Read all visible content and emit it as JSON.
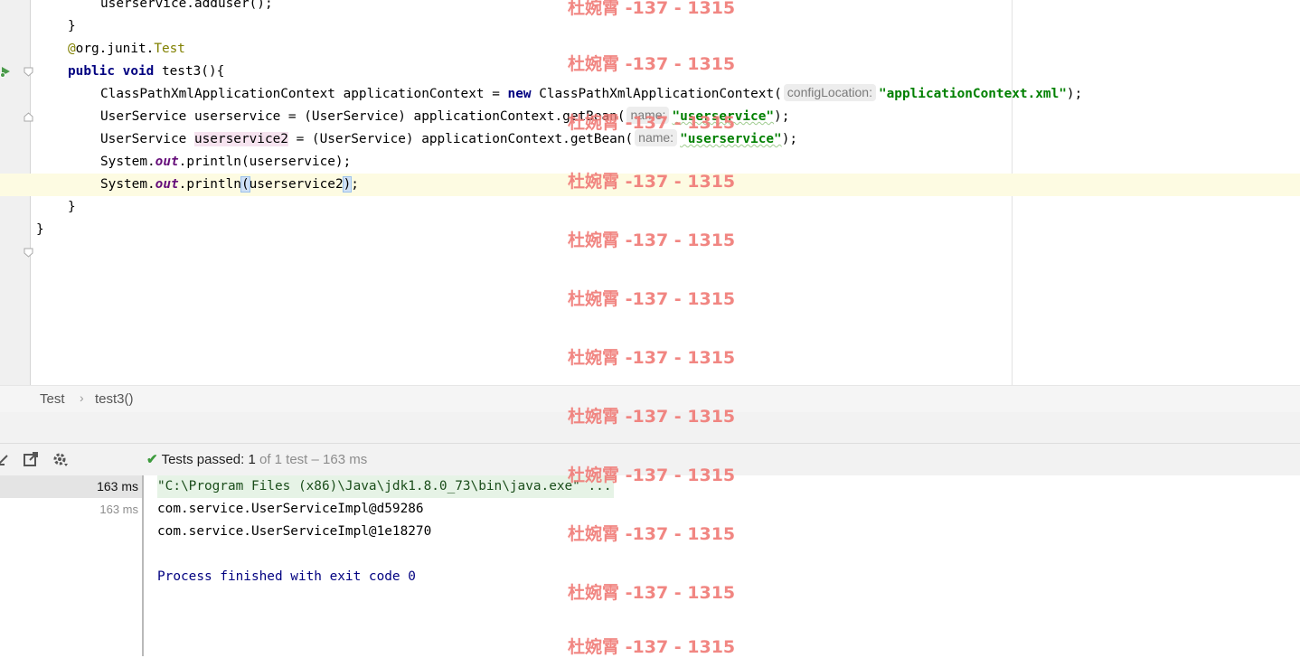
{
  "editor": {
    "lines": {
      "l1": {
        "indent": "        ",
        "text": "userservice.adduser();"
      },
      "l2": {
        "brace": "}"
      },
      "l3": {
        "at": "@",
        "pkg": "org.junit.",
        "name": "Test"
      },
      "l4": {
        "kw1": "public",
        "kw2": "void",
        "rest": " test3(){"
      },
      "l5": {
        "a": "ClassPathXmlApplicationContext applicationContext = ",
        "kw": "new",
        "b": " ClassPathXmlApplicationContext(",
        "hint": "configLocation:",
        "str": "\"applicationContext.xml\"",
        "end": ");"
      },
      "l6": {
        "a": "UserService userservice = (UserService) applicationContext.getBean(",
        "hint": "name:",
        "str": "\"userservice\"",
        "end": ");"
      },
      "l7": {
        "a": "UserService ",
        "var": "userservice2",
        "b": " = (UserService) applicationContext.getBean(",
        "hint": "name:",
        "str": "\"userservice\"",
        "end": ");"
      },
      "l8": {
        "a": "System.",
        "field": "out",
        "b": ".println(userservice);"
      },
      "l9": {
        "a": "System.",
        "field": "out",
        "b": ".println",
        "open": "(",
        "arg": "userservice2",
        "close": ")",
        "end": ";"
      },
      "l10": {
        "brace": "}"
      },
      "l11": {
        "brace": "}"
      }
    }
  },
  "breadcrumb": {
    "class_name": "Test",
    "separator": "›",
    "method": "test3()"
  },
  "run_panel": {
    "status": {
      "check": "✔",
      "label": "Tests passed:",
      "count": "1",
      "detail": "of 1 test – 163 ms"
    },
    "tree": {
      "row1_time": "163 ms",
      "row2_time": "163 ms"
    },
    "console": {
      "cmd": "\"C:\\Program Files (x86)\\Java\\jdk1.8.0_73\\bin\\java.exe\" ...",
      "out1": "com.service.UserServiceImpl@d59286",
      "out2": "com.service.UserServiceImpl@1e18270",
      "exit": "Process finished with exit code 0"
    }
  },
  "watermark": {
    "text": "杜婉霄 -137 - 1315"
  },
  "colors": {
    "keyword": "#000080",
    "string": "#008000",
    "annotation": "#808000",
    "static_field": "#660e7a",
    "watermark": "#f07c78",
    "pass_check": "#3c9a3c"
  }
}
